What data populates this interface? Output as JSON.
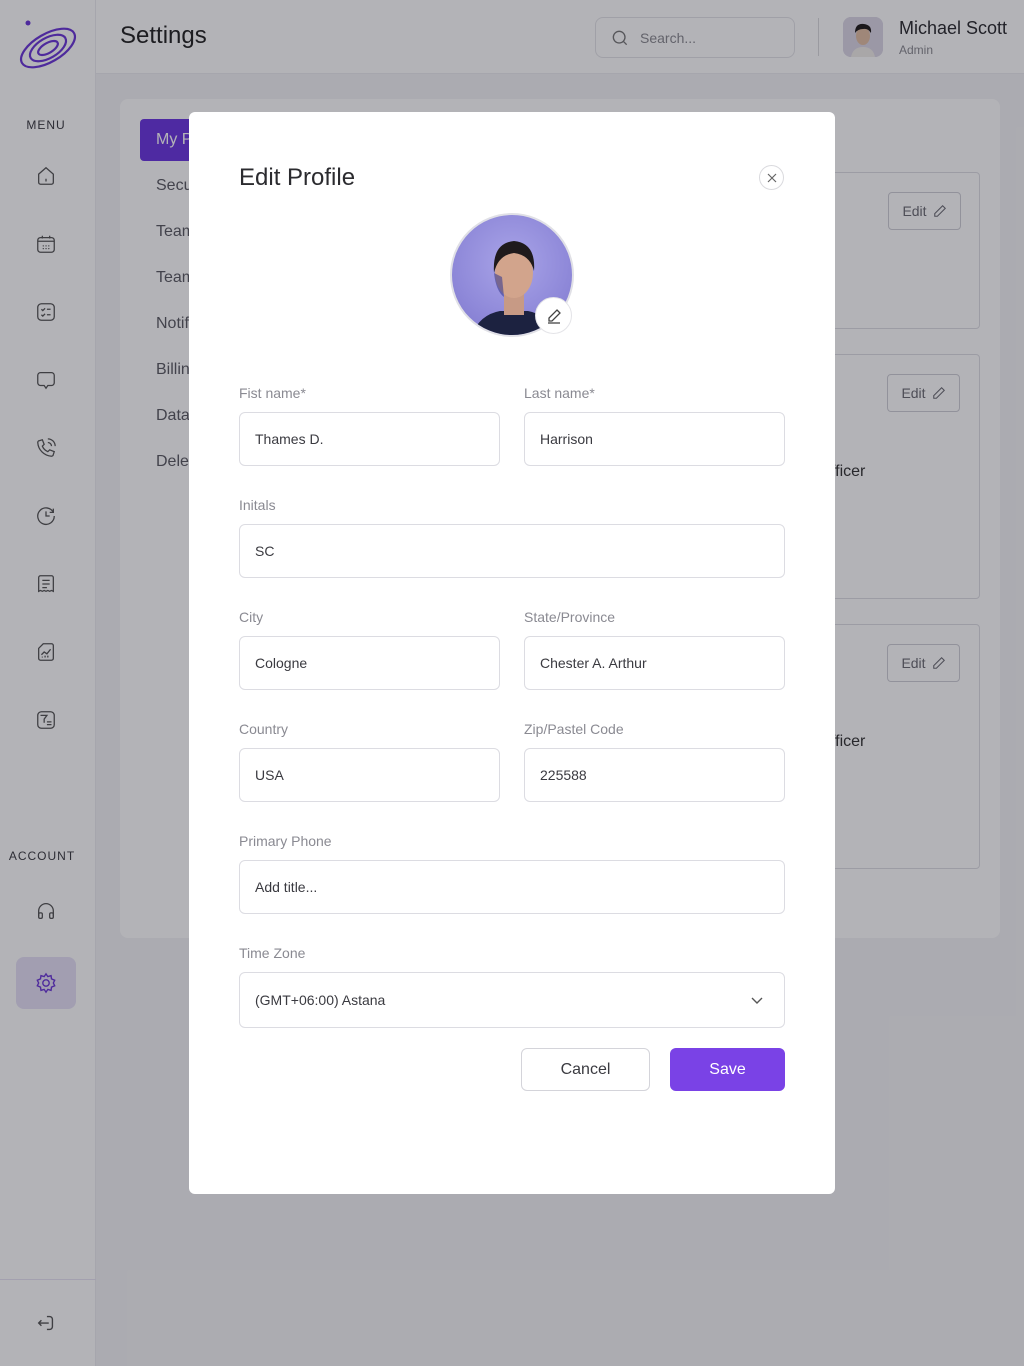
{
  "app": {
    "accent": "#7a42e6",
    "logo": "orbit-logo"
  },
  "header": {
    "title": "Settings",
    "search_placeholder": "Search...",
    "user": {
      "name": "Michael Scott",
      "role": "Admin"
    }
  },
  "sidebar": {
    "menu_label": "MENU",
    "account_label": "ACCOUNT",
    "items": [
      {
        "icon": "home-icon"
      },
      {
        "icon": "calendar-icon"
      },
      {
        "icon": "checklist-icon"
      },
      {
        "icon": "chat-icon"
      },
      {
        "icon": "phone-icon"
      },
      {
        "icon": "clock-icon"
      },
      {
        "icon": "receipt-icon"
      },
      {
        "icon": "report-icon"
      },
      {
        "icon": "filter-icon"
      }
    ],
    "account_items": [
      {
        "icon": "headphones-icon"
      },
      {
        "icon": "gear-icon",
        "active": true
      }
    ],
    "logout_icon": "logout-icon"
  },
  "settings_nav": [
    {
      "label": "My Profile",
      "active": true
    },
    {
      "label": "Security"
    },
    {
      "label": "Teams"
    },
    {
      "label": "Team Member"
    },
    {
      "label": "Notifications"
    },
    {
      "label": "Billing"
    },
    {
      "label": "Data Export"
    },
    {
      "label": "Delete Account"
    }
  ],
  "background_cards": [
    {
      "edit_label": "Edit"
    },
    {
      "edit_label": "Edit",
      "text_fragment": "fficer"
    },
    {
      "edit_label": "Edit",
      "text_fragment": "fficer"
    }
  ],
  "modal": {
    "title": "Edit Profile",
    "fields": {
      "first_name": {
        "label": "Fist name*",
        "value": "Thames D."
      },
      "last_name": {
        "label": "Last name*",
        "value": "Harrison"
      },
      "initials": {
        "label": "Initals",
        "value": "SC"
      },
      "city": {
        "label": "City",
        "value": "Cologne"
      },
      "state": {
        "label": "State/Province",
        "value": "Chester A. Arthur"
      },
      "country": {
        "label": "Country",
        "value": "USA"
      },
      "zip": {
        "label": "Zip/Pastel Code",
        "value": "225588"
      },
      "phone": {
        "label": "Primary Phone",
        "placeholder": "Add title..."
      },
      "timezone": {
        "label": "Time Zone",
        "value": "(GMT+06:00) Astana"
      }
    },
    "cancel_label": "Cancel",
    "save_label": "Save"
  }
}
